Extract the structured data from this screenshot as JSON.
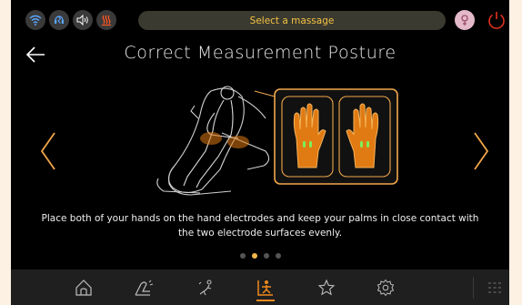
{
  "status": {
    "icons": [
      "wifi-icon",
      "bluetooth-headset-icon",
      "speaker-icon",
      "heat-icon"
    ],
    "message_bar": "Select a massage",
    "avatar": "user-avatar",
    "power": "power-icon"
  },
  "header": {
    "back": "back-arrow-icon",
    "title": "Correct Measurement Posture"
  },
  "content": {
    "instruction": "Place both of your hands on the hand electrodes and keep your palms in close contact with the two electrode surfaces evenly.",
    "page_indicator": {
      "count": 4,
      "active_index": 1
    }
  },
  "bottom_nav": {
    "items": [
      "home-icon",
      "manual-massage-icon",
      "body-shape-icon",
      "health-detection-icon",
      "favorites-star-icon",
      "settings-gear-icon",
      "grid-menu-icon"
    ],
    "active": "health-detection-icon"
  },
  "colors": {
    "accent": "#f08a1c",
    "message_text": "#f5c242",
    "electrode_green": "#7df05a",
    "background": "#000000"
  }
}
